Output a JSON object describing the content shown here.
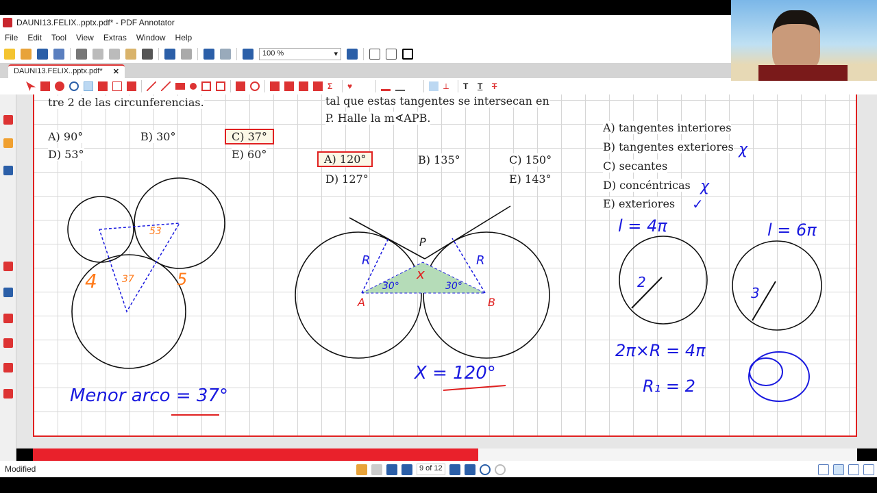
{
  "window": {
    "title": "DAUNI13.FELIX..pptx.pdf* - PDF Annotator"
  },
  "menu": [
    "File",
    "Edit",
    "Tool",
    "View",
    "Extras",
    "Window",
    "Help"
  ],
  "toolbar": {
    "zoom": "100 %"
  },
  "tab": {
    "label": "DAUNI13.FELIX..pptx.pdf*",
    "close": "✕"
  },
  "document": {
    "q1": {
      "text": "tre 2 de las circunferencias.",
      "options": [
        "A) 90°",
        "B) 30°",
        "C) 37°",
        "D) 53°",
        "E) 60°"
      ],
      "selected": "C) 37°"
    },
    "q2": {
      "text1": "tal que estas tangentes se intersecan en",
      "text2": "P. Halle la m∢APB.",
      "options": [
        "A) 120°",
        "B) 135°",
        "C) 150°",
        "D) 127°",
        "E) 143°"
      ],
      "selected": "A) 120°"
    },
    "q3": {
      "options": [
        "A) tangentes interiores",
        "B) tangentes exteriores",
        "C) secantes",
        "D) concéntricas",
        "E) exteriores"
      ]
    },
    "annotations": {
      "a1": "Menor arco = 37°",
      "a2": "X = 120°",
      "a3": "l = 4π",
      "a4": "l = 6π",
      "a5": "2π×R = 4π",
      "a6": "R₁ = 2",
      "labels": {
        "A": "A",
        "B": "B",
        "P": "P",
        "R": "R",
        "x": "x",
        "ang30": "30°",
        "two": "2",
        "three": "3",
        "four": "4",
        "five": "5",
        "r37": "37",
        "r53": "53"
      },
      "marks": [
        "χ",
        "χ",
        "✓"
      ]
    }
  },
  "progress": {
    "percent": 54
  },
  "status": {
    "text": "Modified",
    "page": "9 of 12"
  },
  "colors": {
    "accent": "#e02020",
    "ink_blue": "#1a1adf",
    "ink_orange": "#ff7a1a",
    "fill_green": "#b5dcb8"
  }
}
